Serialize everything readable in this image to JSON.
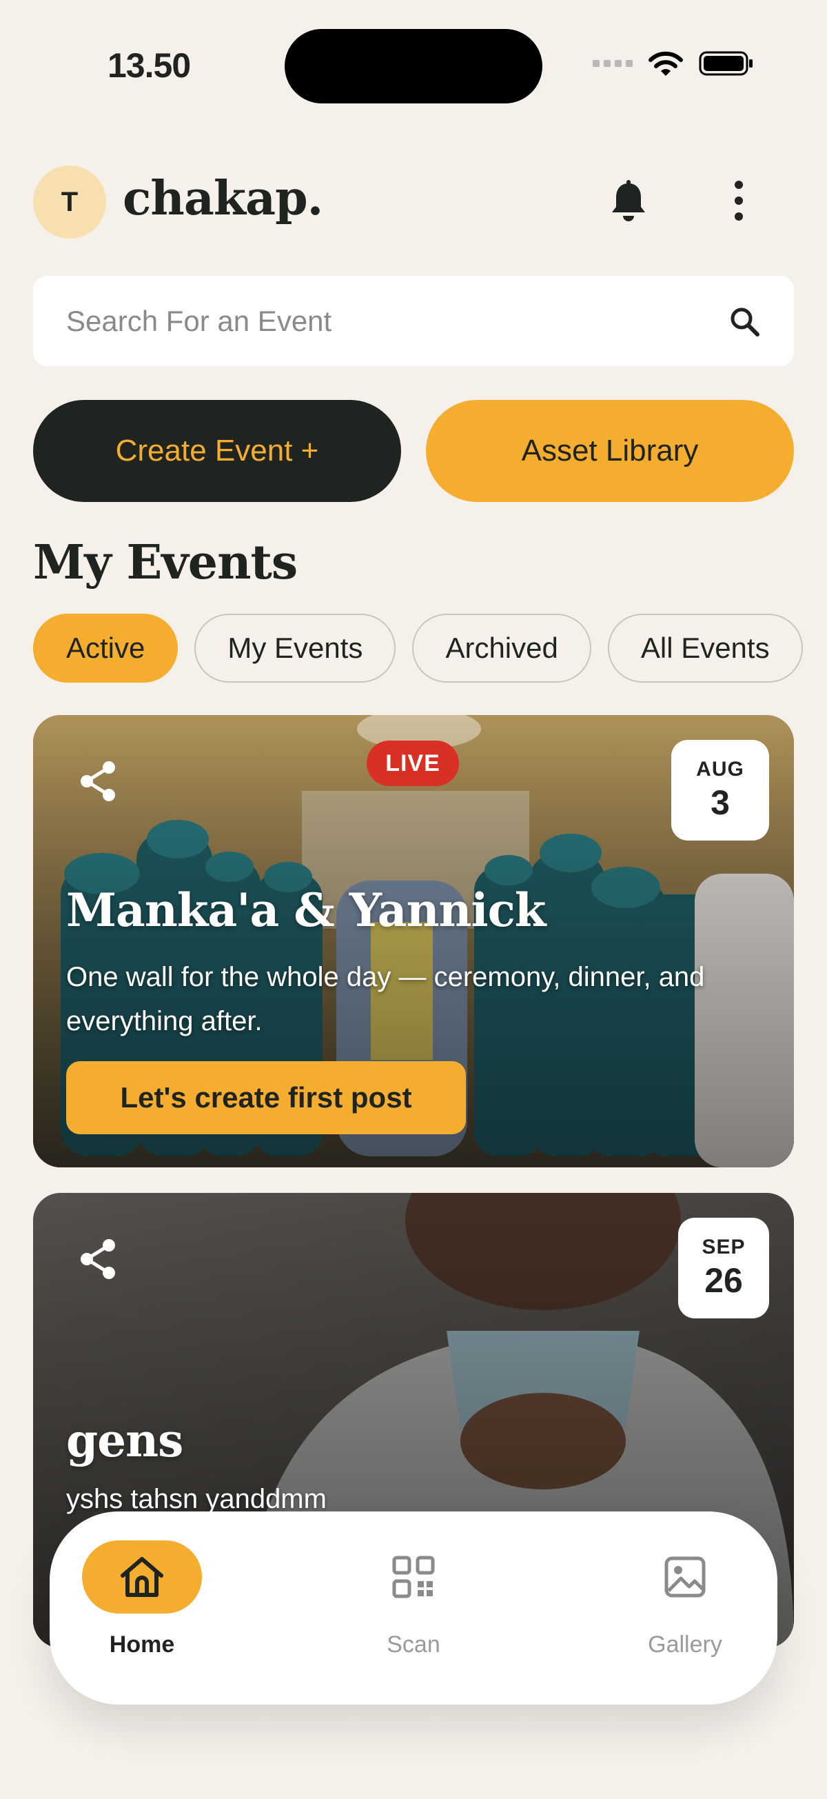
{
  "status_bar": {
    "time": "13.50"
  },
  "header": {
    "avatar_initial": "T",
    "brand": "chakap.",
    "icons": [
      "bell-icon",
      "more-vertical-icon"
    ]
  },
  "search": {
    "placeholder": "Search For an Event",
    "icon": "search-icon"
  },
  "actions": {
    "create_label": "Create Event +",
    "assets_label": "Asset Library"
  },
  "section_title": "My Events",
  "filters": [
    "Active",
    "My Events",
    "Archived",
    "All Events"
  ],
  "active_filter": "Active",
  "events": [
    {
      "badge": "LIVE",
      "month": "AUG",
      "day": "3",
      "title": "Manka'a & Yannick",
      "description": "One wall for the whole day — ceremony, dinner, and everything after.",
      "cta": "Let's create first post"
    },
    {
      "month": "SEP",
      "day": "26",
      "title": "gens",
      "description": "yshs tahsn yanddmm"
    }
  ],
  "nav": [
    {
      "label": "Home",
      "icon": "home-icon",
      "active": true
    },
    {
      "label": "Scan",
      "icon": "qr-code-icon",
      "active": false
    },
    {
      "label": "Gallery",
      "icon": "image-icon",
      "active": false
    }
  ],
  "colors": {
    "accent": "#f4ad2f",
    "dark": "#1f2421",
    "background": "#f5f0ea",
    "live": "#d93025"
  }
}
